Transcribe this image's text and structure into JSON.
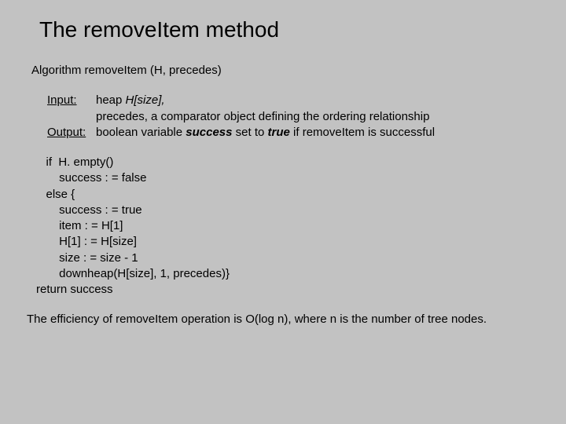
{
  "title": "The removeItem method",
  "algo_header": "Algorithm removeItem (H, precedes)",
  "io": {
    "input_label": "Input:",
    "input_line1_pre": "heap ",
    "input_line1_em": "H[size],",
    "input_line2": "precedes, a comparator object defining the ordering relationship",
    "output_label": "Output:",
    "output_pre1": "boolean variable ",
    "output_b1": "success",
    "output_mid": " set to ",
    "output_b2": "true",
    "output_post": "  if removeItem is successful"
  },
  "code": "   if  H. empty()\n       success : = false\n   else {\n       success : = true\n       item : = H[1]\n       H[1] : = H[size]\n       size : = size - 1\n       downheap(H[size], 1, precedes)}\nreturn success",
  "note": "The efficiency of removeItem operation is O(log n), where n is the number of tree nodes."
}
